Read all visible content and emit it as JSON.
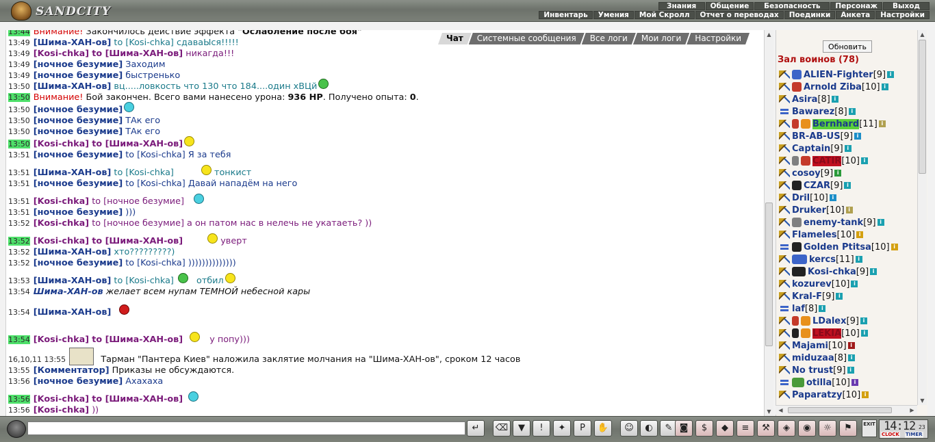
{
  "app": {
    "title": "SANDCITY"
  },
  "top_menu": {
    "row1": [
      {
        "label": "Знания"
      },
      {
        "label": "Общение"
      },
      {
        "label": "Безопасность"
      },
      {
        "label": "Персонаж"
      },
      {
        "label": "Выход"
      }
    ],
    "row2": [
      {
        "label": "Инвентарь"
      },
      {
        "label": "Умения"
      },
      {
        "label": "Мой Скролл"
      },
      {
        "label": "Отчет о переводах"
      },
      {
        "label": "Поединки"
      },
      {
        "label": "Анкета"
      },
      {
        "label": "Настройки"
      }
    ]
  },
  "chat_tabs": [
    {
      "label": "Чат",
      "active": true
    },
    {
      "label": "Системные сообщения",
      "active": false
    },
    {
      "label": "Все логи",
      "active": false
    },
    {
      "label": "Мои логи",
      "active": false
    },
    {
      "label": "Настройки",
      "active": false
    }
  ],
  "chat": {
    "m1": {
      "time": "13:44",
      "warn": "Внимание!",
      "text": " Закончилось действие эффекта ",
      "bold": "\"Ослабление после боя\""
    },
    "m2": {
      "time": "13:49",
      "nick": "[Шима-ХАН-ов]",
      "to": "to [Kosi-chka]",
      "text": " сдаваЫся!!!!!"
    },
    "m3": {
      "time": "13:49",
      "nick": "[Kosi-chka]",
      "to": "to [Шима-ХАН-ов]",
      "text": " никагда!!!"
    },
    "m4": {
      "time": "13:49",
      "nick": "[ночное безумие]",
      "text": " Заходим"
    },
    "m5": {
      "time": "13:49",
      "nick": "[ночное безумие]",
      "text": " быстренько"
    },
    "m6": {
      "time": "13:50",
      "nick": "[Шима-ХАН-ов]",
      "text": " вц.....ловкость что 130 что 184....один хВЦй"
    },
    "m7": {
      "time": "13:50",
      "warn": "Внимание!",
      "text1": " Бой закончен. Всего вами нанесено урона: ",
      "dmg": "936 HP",
      "text2": ". Получено опыта: ",
      "exp": "0",
      "text3": "."
    },
    "m8": {
      "time": "13:50",
      "nick": "[ночное безумие]",
      "text": ""
    },
    "m9": {
      "time": "13:50",
      "nick": "[ночное безумие]",
      "text": " ТАк его"
    },
    "m10": {
      "time": "13:50",
      "nick": "[ночное безумие]",
      "text": " ТАк его"
    },
    "m11": {
      "time": "13:50",
      "nick": "[Kosi-chka]",
      "to": "to [Шима-ХАН-ов]",
      "text": ""
    },
    "m12": {
      "time": "13:51",
      "nick": "[ночное безумие]",
      "to": "to [Kosi-chka]",
      "text": " Я за тебя"
    },
    "m13": {
      "time": "13:51",
      "nick": "[Шима-ХАН-ов]",
      "to": "to [Kosi-chka]",
      "text": " тонкист"
    },
    "m14": {
      "time": "13:51",
      "nick": "[ночное безумие]",
      "to": "to [Kosi-chka]",
      "text": " Давай нападём на него"
    },
    "m15": {
      "time": "13:51",
      "nick": "[Kosi-chka]",
      "to": "to [ночное безумие]",
      "text": ""
    },
    "m16": {
      "time": "13:51",
      "nick": "[ночное безумие]",
      "text": " )))"
    },
    "m17": {
      "time": "13:52",
      "nick": "[Kosi-chka]",
      "to": "to [ночное безумие]",
      "text": " а он патом нас в нелечь не укатаеть? ))"
    },
    "m18": {
      "time": "13:52",
      "nick": "[Kosi-chka]",
      "to": "to [Шима-ХАН-ов]",
      "text": " уверт"
    },
    "m19": {
      "time": "13:52",
      "nick": "[Шима-ХАН-ов]",
      "text": " хто?????????)"
    },
    "m20": {
      "time": "13:52",
      "nick": "[ночное безумие]",
      "to": "to [Kosi-chka]",
      "text": " ))))))))))))))"
    },
    "m21": {
      "time": "13:53",
      "nick": "[Шима-ХАН-ов]",
      "to": "to [Kosi-chka]",
      "text": " отбил"
    },
    "m22": {
      "time": "13:54",
      "nick": "Шима-ХАН-ов",
      "text": " желает всем нупам ТЕМНОЙ небесной кары"
    },
    "m23": {
      "time": "13:54",
      "nick": "[Шима-ХАН-ов]",
      "text": ""
    },
    "m24": {
      "time": "13:54",
      "nick": "[Kosi-chka]",
      "to": "to [Шима-ХАН-ов]",
      "text": " у попу)))"
    },
    "m25": {
      "time": "16,10,11 13:55",
      "text": " Тарман \"Пантера Киев\" наложила заклятие молчания на \"Шима-ХАН-ов\", сроком 12 часов"
    },
    "m26": {
      "time": "13:55",
      "nick": "[Комментатор]",
      "text": " Приказы не обсуждаются."
    },
    "m27": {
      "time": "13:56",
      "nick": "[ночное безумие]",
      "text": " Ахахаха"
    },
    "m28": {
      "time": "13:56",
      "nick": "[Kosi-chka]",
      "to": "to [Шима-ХАН-ов]",
      "text": ""
    },
    "m29": {
      "time": "13:56",
      "nick": "[Kosi-chka]",
      "text": " ))"
    }
  },
  "right_panel": {
    "refresh_label": "Обновить",
    "hall_title": "Зал воинов (78)",
    "users": [
      {
        "name": "ALIEN-Fighter",
        "level": "[9]"
      },
      {
        "name": "Arnold Ziba",
        "level": "[10]"
      },
      {
        "name": "Asira",
        "level": "[8]"
      },
      {
        "name": "Bawarez",
        "level": "[8]"
      },
      {
        "name": "Bernhard",
        "level": "[11]"
      },
      {
        "name": "BR-AB-US",
        "level": "[9]"
      },
      {
        "name": "Captain",
        "level": "[9]"
      },
      {
        "name": "CATIR",
        "level": "[10]"
      },
      {
        "name": "cosoy",
        "level": "[9]"
      },
      {
        "name": "CZAR",
        "level": "[9]"
      },
      {
        "name": "Dril",
        "level": "[10]"
      },
      {
        "name": "Druker",
        "level": "[10]"
      },
      {
        "name": "enemy-tank",
        "level": "[9]"
      },
      {
        "name": "Flameles",
        "level": "[10]"
      },
      {
        "name": "Golden Ptitsa",
        "level": "[10]"
      },
      {
        "name": "kercs",
        "level": "[11]"
      },
      {
        "name": "Kosi-chka",
        "level": "[9]"
      },
      {
        "name": "kozurev",
        "level": "[10]"
      },
      {
        "name": "Kral-F",
        "level": "[9]"
      },
      {
        "name": "laf",
        "level": "[8]"
      },
      {
        "name": "LDalex",
        "level": "[9]"
      },
      {
        "name": "LEKIA",
        "level": "[10]"
      },
      {
        "name": "Majami",
        "level": "[10]"
      },
      {
        "name": "miduzaa",
        "level": "[8]"
      },
      {
        "name": "No trust",
        "level": "[9]"
      },
      {
        "name": "otilla",
        "level": "[10]"
      },
      {
        "name": "Paparatzy",
        "level": "[10]"
      }
    ]
  },
  "bottom": {
    "input_value": "",
    "exit_label": "EXIT",
    "clock_time": "14:12",
    "clock_seconds": "23",
    "clock_label": "CLOCK",
    "timer_label": "TIMER"
  }
}
